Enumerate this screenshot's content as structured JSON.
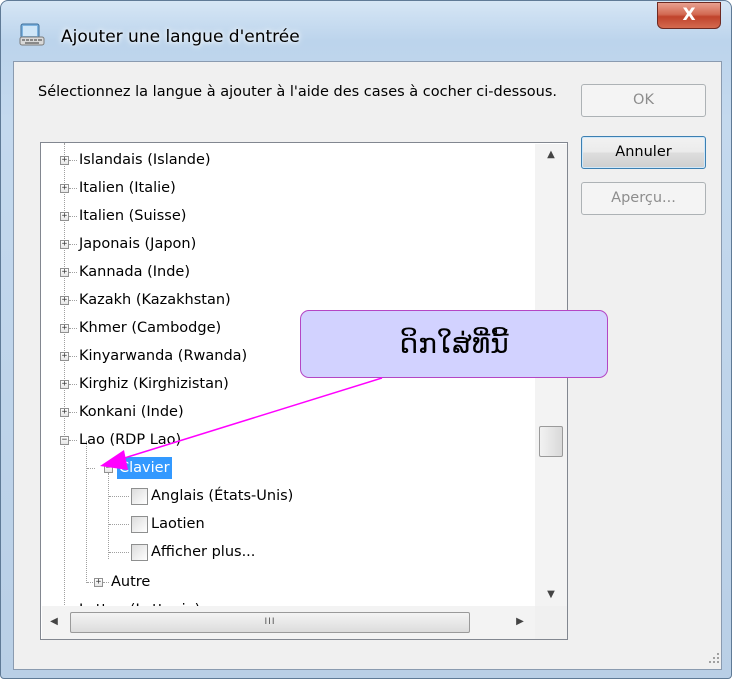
{
  "window": {
    "title": "Ajouter une langue d'entrée",
    "close_label": "X"
  },
  "instruction": "Sélectionnez la langue à ajouter à l'aide des cases à cocher ci-dessous.",
  "buttons": {
    "ok": "OK",
    "cancel": "Annuler",
    "preview": "Aperçu..."
  },
  "tree": {
    "items": [
      {
        "label": "Islandais (Islande)",
        "expander": "+"
      },
      {
        "label": "Italien (Italie)",
        "expander": "+"
      },
      {
        "label": "Italien (Suisse)",
        "expander": "+"
      },
      {
        "label": "Japonais (Japon)",
        "expander": "+"
      },
      {
        "label": "Kannada (Inde)",
        "expander": "+"
      },
      {
        "label": "Kazakh (Kazakhstan)",
        "expander": "+"
      },
      {
        "label": "Khmer (Cambodge)",
        "expander": "+"
      },
      {
        "label": "Kinyarwanda (Rwanda)",
        "expander": "+"
      },
      {
        "label": "Kirghiz (Kirghizistan)",
        "expander": "+"
      },
      {
        "label": "Konkani (Inde)",
        "expander": "+"
      },
      {
        "label": "Lao (RDP Lao)",
        "expander": "−"
      },
      {
        "label": "Clavier",
        "expander": "−",
        "selected": true
      },
      {
        "label": "Anglais (États-Unis)",
        "checked": false
      },
      {
        "label": "Laotien",
        "checked": false
      },
      {
        "label": "Afficher plus...",
        "checked": false
      },
      {
        "label": "Autre",
        "expander": "+"
      },
      {
        "label": "Letton (Lettonie)",
        "expander": "+"
      }
    ]
  },
  "scroll": {
    "h_thumb_grip": "III"
  },
  "callout": {
    "text": "ດິກໃສ່ທີ່ນີ້",
    "color": "#d2d2ff",
    "border_color": "#b446c4",
    "arrow_color": "#ff00ff"
  },
  "colors": {
    "selection": "#3399ff",
    "dialog_bg": "#f0f0f0"
  }
}
